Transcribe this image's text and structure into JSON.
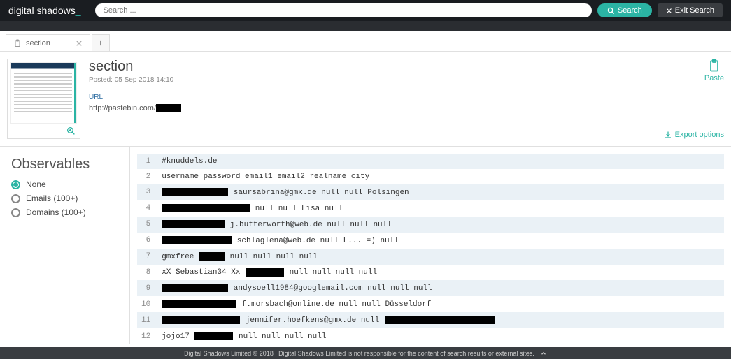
{
  "header": {
    "brand_pre": "digital shadows",
    "brand_cursor": "_",
    "search_placeholder": "Search ...",
    "search_label": "Search",
    "exit_label": "Exit Search"
  },
  "tabs": {
    "active": {
      "label": "section"
    }
  },
  "detail": {
    "title": "section",
    "posted_prefix": "Posted: ",
    "posted_value": "05 Sep 2018 14:10",
    "url_label": "URL",
    "url_value": "http://pastebin.com/",
    "paste_label": "Paste",
    "export_label": "Export options"
  },
  "sidebar": {
    "title": "Observables",
    "options": [
      {
        "label": "None",
        "selected": true
      },
      {
        "label": "Emails (100+)",
        "selected": false
      },
      {
        "label": "Domains (100+)",
        "selected": false
      }
    ]
  },
  "rows": [
    {
      "n": "1",
      "segs": [
        {
          "t": "#knuddels.de"
        }
      ]
    },
    {
      "n": "2",
      "segs": [
        {
          "t": "username password email1 email2 realname city"
        }
      ]
    },
    {
      "n": "3",
      "segs": [
        {
          "r": 94
        },
        {
          "t": " saursabrina@gmx.de null null Polsingen"
        }
      ]
    },
    {
      "n": "4",
      "segs": [
        {
          "r": 125
        },
        {
          "t": " null null Lisa null"
        }
      ]
    },
    {
      "n": "5",
      "segs": [
        {
          "r": 89
        },
        {
          "t": " j.butterworth@web.de null null null"
        }
      ]
    },
    {
      "n": "6",
      "segs": [
        {
          "r": 99
        },
        {
          "t": " schlaglena@web.de null L... =) null"
        }
      ]
    },
    {
      "n": "7",
      "segs": [
        {
          "t": "gmxfree "
        },
        {
          "r": 36
        },
        {
          "t": " null null null null"
        }
      ]
    },
    {
      "n": "8",
      "segs": [
        {
          "t": "xX Sebastian34 Xx "
        },
        {
          "r": 55
        },
        {
          "t": " null null null null"
        }
      ]
    },
    {
      "n": "9",
      "segs": [
        {
          "r": 94
        },
        {
          "t": " andysoell1984@googlemail.com null null null"
        }
      ]
    },
    {
      "n": "10",
      "segs": [
        {
          "r": 106
        },
        {
          "t": " f.morsbach@online.de null null Düsseldorf"
        }
      ]
    },
    {
      "n": "11",
      "segs": [
        {
          "r": 111
        },
        {
          "t": " jennifer.hoefkens@gmx.de null "
        },
        {
          "r": 158
        }
      ]
    },
    {
      "n": "12",
      "segs": [
        {
          "t": "jojo17 "
        },
        {
          "r": 55
        },
        {
          "t": " null null null null"
        }
      ]
    }
  ],
  "footer": {
    "text": "Digital Shadows Limited © 2018 | Digital Shadows Limited is not responsible for the content of search results or external sites."
  }
}
